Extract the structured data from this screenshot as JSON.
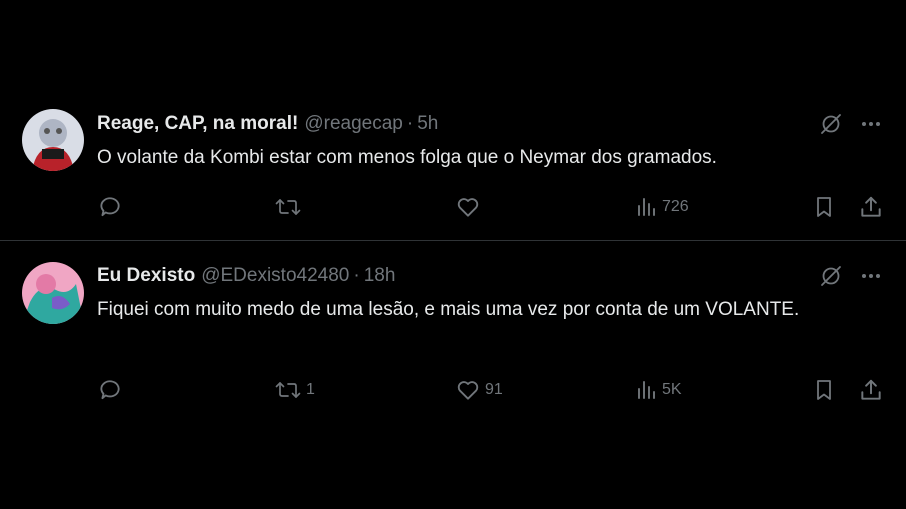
{
  "tweets": [
    {
      "name": "Reage, CAP, na moral!",
      "handle": "@reagecap",
      "separator": "·",
      "time": "5h",
      "text": "O volante da Kombi estar com menos folga que o Neymar dos gramados.",
      "replies": "",
      "retweets": "",
      "likes": "",
      "views": "726",
      "avatar_colors": [
        "#c3c8d6",
        "#b8222a"
      ]
    },
    {
      "name": "Eu Dexisto",
      "handle": "@EDexisto42480",
      "separator": "·",
      "time": "18h",
      "text": "Fiquei com muito medo de uma lesão, e mais uma vez por conta de um VOLANTE.",
      "replies": "",
      "retweets": "1",
      "likes": "91",
      "views": "5K",
      "avatar_colors": [
        "#e890b4",
        "#2fa8a0"
      ]
    }
  ],
  "icons": {
    "reply": "reply-icon",
    "retweet": "retweet-icon",
    "like": "heart-icon",
    "views": "views-icon",
    "bookmark": "bookmark-icon",
    "share": "share-icon",
    "grok": "grok-icon",
    "more": "more-icon"
  },
  "colors": {
    "background": "#000000",
    "text": "#e7e9ea",
    "muted": "#71767b",
    "divider": "#2f3336"
  }
}
